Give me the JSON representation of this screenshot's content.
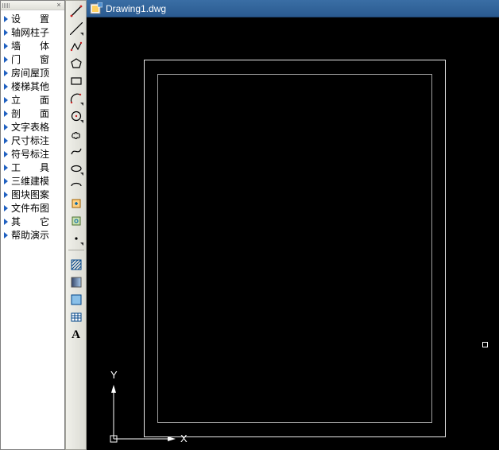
{
  "menu": {
    "items": [
      {
        "label": "设　　置"
      },
      {
        "label": "轴网柱子"
      },
      {
        "label": "墙　　体"
      },
      {
        "label": "门　　窗"
      },
      {
        "label": "房间屋顶"
      },
      {
        "label": "楼梯其他"
      },
      {
        "label": "立　　面"
      },
      {
        "label": "剖　　面"
      },
      {
        "label": "文字表格"
      },
      {
        "label": "尺寸标注"
      },
      {
        "label": "符号标注"
      },
      {
        "label": "工　　具"
      },
      {
        "label": "三维建模"
      },
      {
        "label": "图块图案"
      },
      {
        "label": "文件布图"
      },
      {
        "label": "其　　它"
      },
      {
        "label": "帮助演示"
      }
    ]
  },
  "tools": {
    "items": [
      {
        "name": "line-tool",
        "flyout": false
      },
      {
        "name": "construction-line-tool",
        "flyout": true
      },
      {
        "name": "polyline-tool",
        "flyout": false
      },
      {
        "name": "polygon-tool",
        "flyout": false
      },
      {
        "name": "rectangle-tool",
        "flyout": false
      },
      {
        "name": "arc-tool",
        "flyout": true
      },
      {
        "name": "circle-tool",
        "flyout": true
      },
      {
        "name": "revision-cloud-tool",
        "flyout": false
      },
      {
        "name": "spline-tool",
        "flyout": false
      },
      {
        "name": "ellipse-tool",
        "flyout": true
      },
      {
        "name": "ellipse-arc-tool",
        "flyout": false
      },
      {
        "name": "insert-block-tool",
        "flyout": false
      },
      {
        "name": "make-block-tool",
        "flyout": false
      },
      {
        "name": "point-tool",
        "flyout": true
      }
    ],
    "bottom": [
      {
        "name": "hatch-tool",
        "label": ""
      },
      {
        "name": "gradient-tool",
        "label": ""
      },
      {
        "name": "region-tool",
        "label": ""
      },
      {
        "name": "table-tool",
        "label": ""
      },
      {
        "name": "text-tool",
        "label": "A"
      }
    ]
  },
  "drawing": {
    "title": "Drawing1.dwg",
    "ucs": {
      "x": "X",
      "y": "Y"
    }
  },
  "colors": {
    "titlebar": "#2a5a90",
    "canvas": "#000000",
    "outer_rect": "#e8e8e8",
    "inner_rect": "#a0a0a0"
  }
}
